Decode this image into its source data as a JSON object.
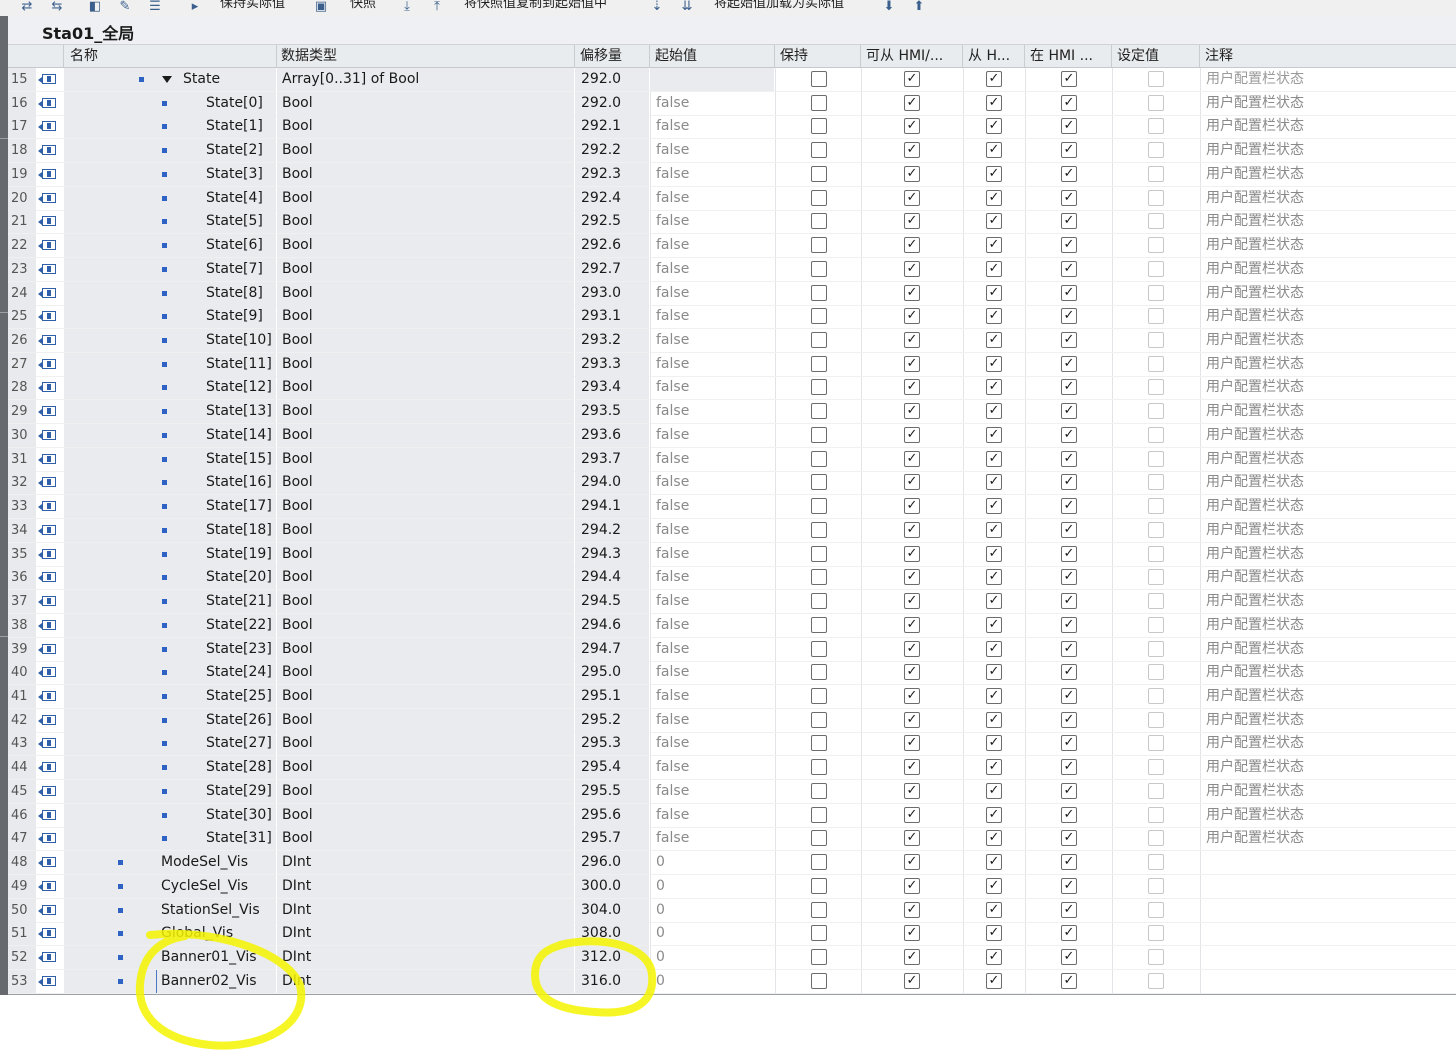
{
  "toolbar": {
    "items": [
      {
        "icon": "snapshot-icon"
      },
      {
        "icon": "snapshot-compare-icon"
      },
      {
        "icon": "monitor-icon"
      },
      {
        "icon": "edit-icon"
      },
      {
        "icon": "list-icon"
      },
      {
        "icon": "play-icon"
      },
      {
        "label": "保持实际值"
      },
      {
        "icon": "camera-icon"
      },
      {
        "label": "快照"
      },
      {
        "icon": "copy-down-icon"
      },
      {
        "icon": "copy-up-icon"
      },
      {
        "label": "将快照值复制到起始值中"
      },
      {
        "icon": "load-icon"
      },
      {
        "icon": "load-all-icon"
      },
      {
        "label": "将起始值加载为实际值"
      },
      {
        "icon": "download-icon"
      },
      {
        "icon": "upload-icon"
      }
    ]
  },
  "db_title": "Sta01_全局",
  "columns": {
    "name": "名称",
    "type": "数据类型",
    "offset": "偏移量",
    "start": "起始值",
    "retain": "保持",
    "hmi_access": "可从 HMI/...",
    "from_hmi": "从 H...",
    "in_hmi": "在 HMI ...",
    "setpoint": "设定值",
    "comment": "注释"
  },
  "rows": [
    {
      "num": "15",
      "name": "State",
      "type": "Array[0..31] of Bool",
      "offset": "292.0",
      "start": "",
      "comment": "用户配置栏状态",
      "level": "array",
      "retain": false,
      "hmi": true,
      "fromhmi": true,
      "inhmi": true
    },
    {
      "num": "16",
      "name": "State[0]",
      "type": "Bool",
      "offset": "292.0",
      "start": "false",
      "comment": "用户配置栏状态",
      "level": "element",
      "retain": false,
      "hmi": true,
      "fromhmi": true,
      "inhmi": true
    },
    {
      "num": "17",
      "name": "State[1]",
      "type": "Bool",
      "offset": "292.1",
      "start": "false",
      "comment": "用户配置栏状态",
      "level": "element",
      "retain": false,
      "hmi": true,
      "fromhmi": true,
      "inhmi": true
    },
    {
      "num": "18",
      "name": "State[2]",
      "type": "Bool",
      "offset": "292.2",
      "start": "false",
      "comment": "用户配置栏状态",
      "level": "element",
      "retain": false,
      "hmi": true,
      "fromhmi": true,
      "inhmi": true
    },
    {
      "num": "19",
      "name": "State[3]",
      "type": "Bool",
      "offset": "292.3",
      "start": "false",
      "comment": "用户配置栏状态",
      "level": "element",
      "retain": false,
      "hmi": true,
      "fromhmi": true,
      "inhmi": true
    },
    {
      "num": "20",
      "name": "State[4]",
      "type": "Bool",
      "offset": "292.4",
      "start": "false",
      "comment": "用户配置栏状态",
      "level": "element",
      "retain": false,
      "hmi": true,
      "fromhmi": true,
      "inhmi": true
    },
    {
      "num": "21",
      "name": "State[5]",
      "type": "Bool",
      "offset": "292.5",
      "start": "false",
      "comment": "用户配置栏状态",
      "level": "element",
      "retain": false,
      "hmi": true,
      "fromhmi": true,
      "inhmi": true
    },
    {
      "num": "22",
      "name": "State[6]",
      "type": "Bool",
      "offset": "292.6",
      "start": "false",
      "comment": "用户配置栏状态",
      "level": "element",
      "retain": false,
      "hmi": true,
      "fromhmi": true,
      "inhmi": true
    },
    {
      "num": "23",
      "name": "State[7]",
      "type": "Bool",
      "offset": "292.7",
      "start": "false",
      "comment": "用户配置栏状态",
      "level": "element",
      "retain": false,
      "hmi": true,
      "fromhmi": true,
      "inhmi": true
    },
    {
      "num": "24",
      "name": "State[8]",
      "type": "Bool",
      "offset": "293.0",
      "start": "false",
      "comment": "用户配置栏状态",
      "level": "element",
      "retain": false,
      "hmi": true,
      "fromhmi": true,
      "inhmi": true
    },
    {
      "num": "25",
      "name": "State[9]",
      "type": "Bool",
      "offset": "293.1",
      "start": "false",
      "comment": "用户配置栏状态",
      "level": "element",
      "retain": false,
      "hmi": true,
      "fromhmi": true,
      "inhmi": true
    },
    {
      "num": "26",
      "name": "State[10]",
      "type": "Bool",
      "offset": "293.2",
      "start": "false",
      "comment": "用户配置栏状态",
      "level": "element",
      "retain": false,
      "hmi": true,
      "fromhmi": true,
      "inhmi": true
    },
    {
      "num": "27",
      "name": "State[11]",
      "type": "Bool",
      "offset": "293.3",
      "start": "false",
      "comment": "用户配置栏状态",
      "level": "element",
      "retain": false,
      "hmi": true,
      "fromhmi": true,
      "inhmi": true
    },
    {
      "num": "28",
      "name": "State[12]",
      "type": "Bool",
      "offset": "293.4",
      "start": "false",
      "comment": "用户配置栏状态",
      "level": "element",
      "retain": false,
      "hmi": true,
      "fromhmi": true,
      "inhmi": true
    },
    {
      "num": "29",
      "name": "State[13]",
      "type": "Bool",
      "offset": "293.5",
      "start": "false",
      "comment": "用户配置栏状态",
      "level": "element",
      "retain": false,
      "hmi": true,
      "fromhmi": true,
      "inhmi": true
    },
    {
      "num": "30",
      "name": "State[14]",
      "type": "Bool",
      "offset": "293.6",
      "start": "false",
      "comment": "用户配置栏状态",
      "level": "element",
      "retain": false,
      "hmi": true,
      "fromhmi": true,
      "inhmi": true
    },
    {
      "num": "31",
      "name": "State[15]",
      "type": "Bool",
      "offset": "293.7",
      "start": "false",
      "comment": "用户配置栏状态",
      "level": "element",
      "retain": false,
      "hmi": true,
      "fromhmi": true,
      "inhmi": true
    },
    {
      "num": "32",
      "name": "State[16]",
      "type": "Bool",
      "offset": "294.0",
      "start": "false",
      "comment": "用户配置栏状态",
      "level": "element",
      "retain": false,
      "hmi": true,
      "fromhmi": true,
      "inhmi": true
    },
    {
      "num": "33",
      "name": "State[17]",
      "type": "Bool",
      "offset": "294.1",
      "start": "false",
      "comment": "用户配置栏状态",
      "level": "element",
      "retain": false,
      "hmi": true,
      "fromhmi": true,
      "inhmi": true
    },
    {
      "num": "34",
      "name": "State[18]",
      "type": "Bool",
      "offset": "294.2",
      "start": "false",
      "comment": "用户配置栏状态",
      "level": "element",
      "retain": false,
      "hmi": true,
      "fromhmi": true,
      "inhmi": true
    },
    {
      "num": "35",
      "name": "State[19]",
      "type": "Bool",
      "offset": "294.3",
      "start": "false",
      "comment": "用户配置栏状态",
      "level": "element",
      "retain": false,
      "hmi": true,
      "fromhmi": true,
      "inhmi": true
    },
    {
      "num": "36",
      "name": "State[20]",
      "type": "Bool",
      "offset": "294.4",
      "start": "false",
      "comment": "用户配置栏状态",
      "level": "element",
      "retain": false,
      "hmi": true,
      "fromhmi": true,
      "inhmi": true
    },
    {
      "num": "37",
      "name": "State[21]",
      "type": "Bool",
      "offset": "294.5",
      "start": "false",
      "comment": "用户配置栏状态",
      "level": "element",
      "retain": false,
      "hmi": true,
      "fromhmi": true,
      "inhmi": true
    },
    {
      "num": "38",
      "name": "State[22]",
      "type": "Bool",
      "offset": "294.6",
      "start": "false",
      "comment": "用户配置栏状态",
      "level": "element",
      "retain": false,
      "hmi": true,
      "fromhmi": true,
      "inhmi": true
    },
    {
      "num": "39",
      "name": "State[23]",
      "type": "Bool",
      "offset": "294.7",
      "start": "false",
      "comment": "用户配置栏状态",
      "level": "element",
      "retain": false,
      "hmi": true,
      "fromhmi": true,
      "inhmi": true
    },
    {
      "num": "40",
      "name": "State[24]",
      "type": "Bool",
      "offset": "295.0",
      "start": "false",
      "comment": "用户配置栏状态",
      "level": "element",
      "retain": false,
      "hmi": true,
      "fromhmi": true,
      "inhmi": true
    },
    {
      "num": "41",
      "name": "State[25]",
      "type": "Bool",
      "offset": "295.1",
      "start": "false",
      "comment": "用户配置栏状态",
      "level": "element",
      "retain": false,
      "hmi": true,
      "fromhmi": true,
      "inhmi": true
    },
    {
      "num": "42",
      "name": "State[26]",
      "type": "Bool",
      "offset": "295.2",
      "start": "false",
      "comment": "用户配置栏状态",
      "level": "element",
      "retain": false,
      "hmi": true,
      "fromhmi": true,
      "inhmi": true
    },
    {
      "num": "43",
      "name": "State[27]",
      "type": "Bool",
      "offset": "295.3",
      "start": "false",
      "comment": "用户配置栏状态",
      "level": "element",
      "retain": false,
      "hmi": true,
      "fromhmi": true,
      "inhmi": true
    },
    {
      "num": "44",
      "name": "State[28]",
      "type": "Bool",
      "offset": "295.4",
      "start": "false",
      "comment": "用户配置栏状态",
      "level": "element",
      "retain": false,
      "hmi": true,
      "fromhmi": true,
      "inhmi": true
    },
    {
      "num": "45",
      "name": "State[29]",
      "type": "Bool",
      "offset": "295.5",
      "start": "false",
      "comment": "用户配置栏状态",
      "level": "element",
      "retain": false,
      "hmi": true,
      "fromhmi": true,
      "inhmi": true
    },
    {
      "num": "46",
      "name": "State[30]",
      "type": "Bool",
      "offset": "295.6",
      "start": "false",
      "comment": "用户配置栏状态",
      "level": "element",
      "retain": false,
      "hmi": true,
      "fromhmi": true,
      "inhmi": true
    },
    {
      "num": "47",
      "name": "State[31]",
      "type": "Bool",
      "offset": "295.7",
      "start": "false",
      "comment": "用户配置栏状态",
      "level": "element",
      "retain": false,
      "hmi": true,
      "fromhmi": true,
      "inhmi": true
    },
    {
      "num": "48",
      "name": "ModeSel_Vis",
      "type": "DInt",
      "offset": "296.0",
      "start": "0",
      "comment": "",
      "level": "member",
      "retain": false,
      "hmi": true,
      "fromhmi": true,
      "inhmi": true
    },
    {
      "num": "49",
      "name": "CycleSel_Vis",
      "type": "DInt",
      "offset": "300.0",
      "start": "0",
      "comment": "",
      "level": "member",
      "retain": false,
      "hmi": true,
      "fromhmi": true,
      "inhmi": true
    },
    {
      "num": "50",
      "name": "StationSel_Vis",
      "type": "DInt",
      "offset": "304.0",
      "start": "0",
      "comment": "",
      "level": "member",
      "retain": false,
      "hmi": true,
      "fromhmi": true,
      "inhmi": true
    },
    {
      "num": "51",
      "name": "Global_Vis",
      "type": "DInt",
      "offset": "308.0",
      "start": "0",
      "comment": "",
      "level": "member",
      "retain": false,
      "hmi": true,
      "fromhmi": true,
      "inhmi": true
    },
    {
      "num": "52",
      "name": "Banner01_Vis",
      "type": "DInt",
      "offset": "312.0",
      "start": "0",
      "comment": "",
      "level": "member",
      "retain": false,
      "hmi": true,
      "fromhmi": true,
      "inhmi": true
    },
    {
      "num": "53",
      "name": "Banner02_Vis",
      "type": "DInt",
      "offset": "316.0",
      "start": "0",
      "comment": "",
      "level": "member",
      "retain": false,
      "hmi": true,
      "fromhmi": true,
      "inhmi": true,
      "selected": true
    }
  ],
  "colors": {
    "highlight": "#f5f500",
    "bullet": "#2e62c4",
    "grid_bg": "#e9ebee"
  }
}
